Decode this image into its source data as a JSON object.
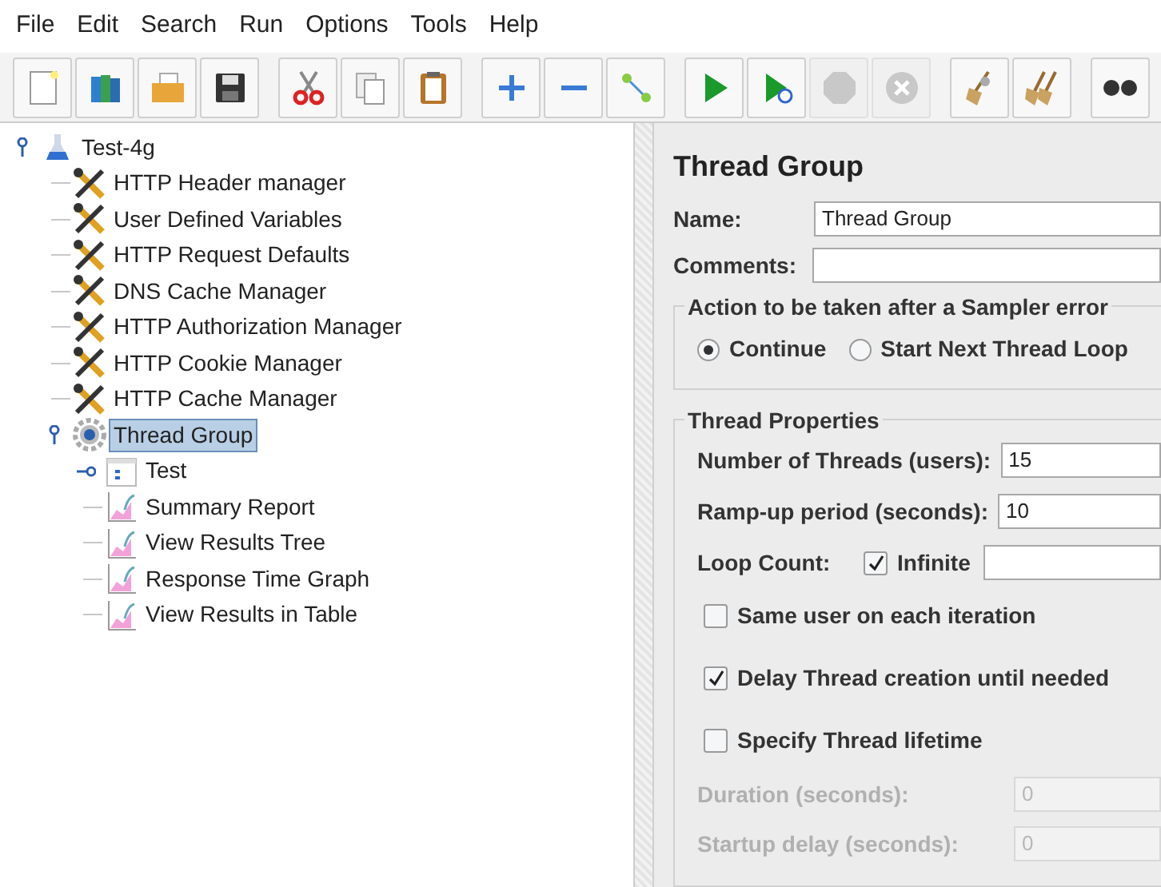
{
  "menu": [
    "File",
    "Edit",
    "Search",
    "Run",
    "Options",
    "Tools",
    "Help"
  ],
  "toolbar": [
    [
      {
        "kind": "new",
        "disabled": false
      },
      {
        "kind": "templates",
        "disabled": false
      },
      {
        "kind": "open",
        "disabled": false
      },
      {
        "kind": "save",
        "disabled": false
      }
    ],
    [
      {
        "kind": "cut",
        "disabled": false
      },
      {
        "kind": "copy",
        "disabled": false
      },
      {
        "kind": "paste",
        "disabled": false
      }
    ],
    [
      {
        "kind": "expand",
        "disabled": false
      },
      {
        "kind": "collapse",
        "disabled": false
      },
      {
        "kind": "toggle",
        "disabled": false
      }
    ],
    [
      {
        "kind": "start",
        "disabled": false
      },
      {
        "kind": "start-no-pause",
        "disabled": false
      },
      {
        "kind": "stop",
        "disabled": true
      },
      {
        "kind": "shutdown",
        "disabled": true
      }
    ],
    [
      {
        "kind": "clear",
        "disabled": false
      },
      {
        "kind": "clear-all",
        "disabled": false
      }
    ],
    [
      {
        "kind": "search",
        "disabled": false
      }
    ]
  ],
  "tree": [
    {
      "label": "Test-4g",
      "kind": "plan",
      "selected": false,
      "expanded": true,
      "children": [
        {
          "label": "HTTP Header manager",
          "kind": "config",
          "selected": false
        },
        {
          "label": "User Defined Variables",
          "kind": "config",
          "selected": false
        },
        {
          "label": "HTTP Request Defaults",
          "kind": "config",
          "selected": false
        },
        {
          "label": "DNS Cache Manager",
          "kind": "config",
          "selected": false
        },
        {
          "label": "HTTP Authorization Manager",
          "kind": "config",
          "selected": false
        },
        {
          "label": "HTTP Cookie Manager",
          "kind": "config",
          "selected": false
        },
        {
          "label": "HTTP Cache Manager",
          "kind": "config",
          "selected": false
        },
        {
          "label": "Thread Group",
          "kind": "thread",
          "selected": true,
          "expanded": true,
          "children": [
            {
              "label": "Test",
              "kind": "controller",
              "selected": false,
              "expanded": false
            },
            {
              "label": "Summary Report",
              "kind": "listener",
              "selected": false
            },
            {
              "label": "View Results Tree",
              "kind": "listener",
              "selected": false
            },
            {
              "label": "Response Time Graph",
              "kind": "listener",
              "selected": false
            },
            {
              "label": "View Results in Table",
              "kind": "listener",
              "selected": false
            }
          ]
        }
      ]
    }
  ],
  "panel": {
    "title": "Thread Group",
    "name": {
      "label": "Name:",
      "value": "Thread Group"
    },
    "comments": {
      "label": "Comments:"
    },
    "error_action": {
      "title": "Action to be taken after a Sampler error",
      "options": [
        {
          "label": "Continue",
          "selected": true
        },
        {
          "label": "Start Next Thread Loop",
          "selected": false
        }
      ]
    },
    "properties": {
      "title": "Thread Properties",
      "threads": {
        "label": "Number of Threads (users):",
        "value": "15"
      },
      "ramp_up": {
        "label": "Ramp-up period (seconds):",
        "value": "10"
      },
      "loop_count": {
        "label": "Loop Count:",
        "infinite": {
          "label": "Infinite",
          "checked": true
        }
      },
      "checks": [
        {
          "label": "Same user on each iteration",
          "checked": false
        },
        {
          "label": "Delay Thread creation until needed",
          "checked": true
        },
        {
          "label": "Specify Thread lifetime",
          "checked": false
        }
      ],
      "duration": {
        "label": "Duration (seconds):",
        "value": "0",
        "disabled": true
      },
      "startup_delay": {
        "label": "Startup delay (seconds):",
        "value": "0",
        "disabled": true
      }
    }
  }
}
